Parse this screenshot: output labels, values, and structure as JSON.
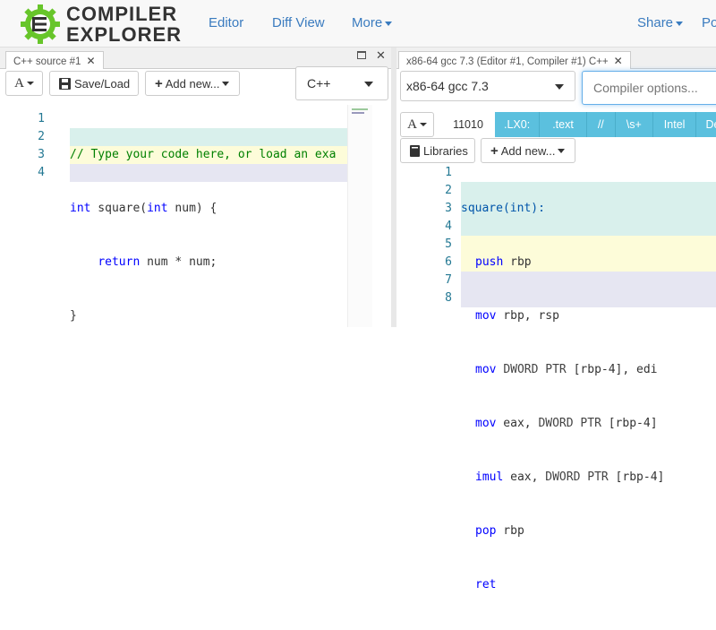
{
  "nav": {
    "logo_line1": "COMPILER",
    "logo_line2": "EXPLORER",
    "editor": "Editor",
    "diff_view": "Diff View",
    "more": "More",
    "share": "Share",
    "policies": "Policies",
    "brand_color": "#67c52a"
  },
  "editor_pane": {
    "tab_title": "C++ source #1",
    "font_btn": "A",
    "save_load": "Save/Load",
    "add_new": "Add new...",
    "language": "C++",
    "lines": [
      {
        "n": "1",
        "text": "// Type your code here, or load an exa"
      },
      {
        "n": "2",
        "text": "int square(int num) {"
      },
      {
        "n": "3",
        "text": "    return num * num;"
      },
      {
        "n": "4",
        "text": "}"
      }
    ]
  },
  "compiler_pane": {
    "tab_title": "x86-64 gcc 7.3 (Editor #1, Compiler #1) C++",
    "compiler": "x86-64 gcc 7.3",
    "options_placeholder": "Compiler options...",
    "font_btn": "A",
    "filters": [
      "11010",
      ".LX0:",
      ".text",
      "//",
      "\\s+",
      "Intel",
      "Dem"
    ],
    "libraries": "Libraries",
    "add_new": "Add new...",
    "asm": [
      {
        "n": "1",
        "text": "square(int):"
      },
      {
        "n": "2",
        "text": "push rbp"
      },
      {
        "n": "3",
        "text": "mov rbp, rsp"
      },
      {
        "n": "4",
        "text": "mov DWORD PTR [rbp-4], edi"
      },
      {
        "n": "5",
        "text": "mov eax, DWORD PTR [rbp-4]"
      },
      {
        "n": "6",
        "text": "imul eax, DWORD PTR [rbp-4]"
      },
      {
        "n": "7",
        "text": "pop rbp"
      },
      {
        "n": "8",
        "text": "ret"
      }
    ]
  }
}
